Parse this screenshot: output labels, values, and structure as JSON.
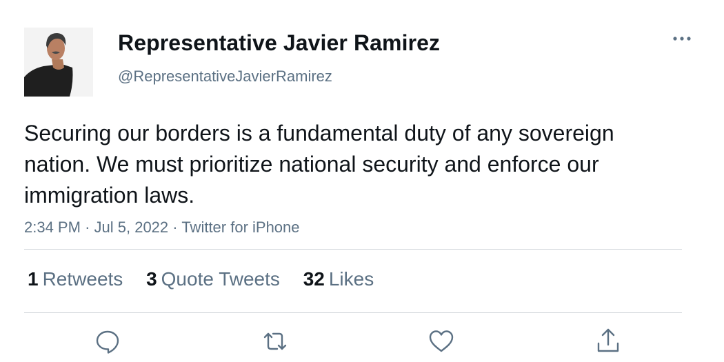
{
  "author": {
    "display_name": "Representative Javier Ramirez",
    "handle": "@RepresentativeJavierRamirez"
  },
  "tweet": {
    "text": "Securing our borders is a fundamental duty of any sovereign nation. We must prioritize national security and enforce our immigration laws.",
    "time": "2:34 PM",
    "date": "Jul 5, 2022",
    "source": "Twitter for iPhone",
    "separator": "·"
  },
  "stats": {
    "retweets_count": "1",
    "retweets_label": "Retweets",
    "quotes_count": "3",
    "quotes_label": "Quote Tweets",
    "likes_count": "32",
    "likes_label": "Likes"
  },
  "actions": {
    "reply_icon": "reply-icon",
    "retweet_icon": "retweet-icon",
    "like_icon": "heart-icon",
    "share_icon": "share-icon",
    "more_icon": "more-horizontal-icon"
  },
  "colors": {
    "text": "#0f1419",
    "secondary": "#5b7083",
    "divider": "#d3d8dc",
    "icon": "#5b7083"
  }
}
